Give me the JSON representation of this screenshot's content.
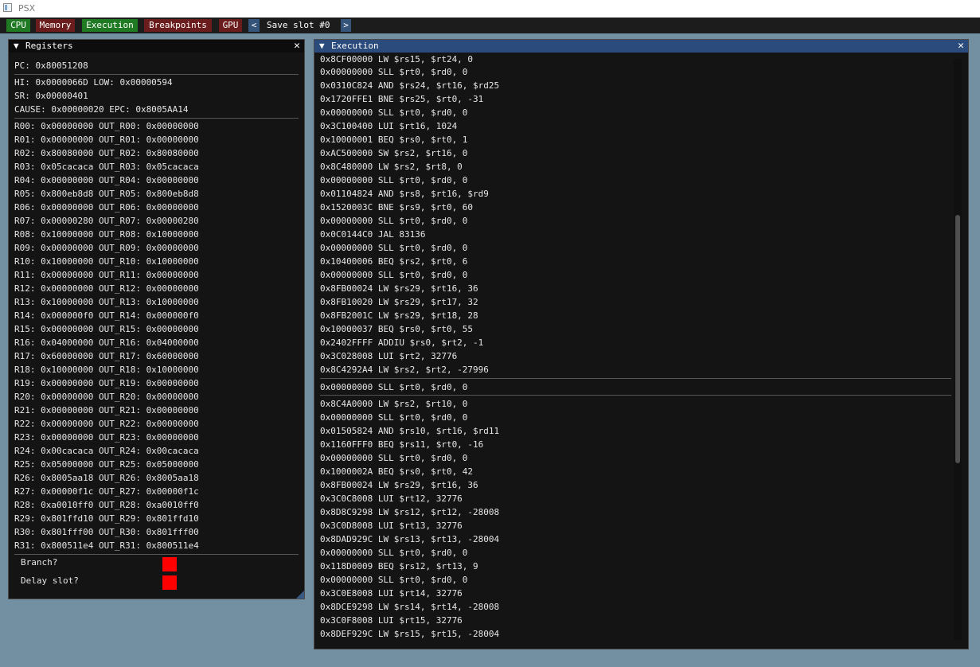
{
  "os_window": {
    "title": "PSX"
  },
  "menubar": {
    "buttons": [
      "CPU",
      "Memory",
      "Execution",
      "Breakpoints",
      "GPU"
    ],
    "prev_label": "<",
    "save_slot_label": "Save slot #0",
    "next_label": ">"
  },
  "registers_window": {
    "title": "Registers",
    "arrow": "▼",
    "close": "✕",
    "pc": "PC: 0x80051208",
    "hi_low": "HI: 0x0000066D LOW: 0x00000594",
    "sr": "SR: 0x00000401",
    "cause_epc": "CAUSE: 0x00000020 EPC: 0x8005AA14",
    "rows": [
      "R00: 0x00000000 OUT_R00: 0x00000000",
      "R01: 0x00000000 OUT_R01: 0x00000000",
      "R02: 0x80080000 OUT_R02: 0x80080000",
      "R03: 0x05cacaca OUT_R03: 0x05cacaca",
      "R04: 0x00000000 OUT_R04: 0x00000000",
      "R05: 0x800eb8d8 OUT_R05: 0x800eb8d8",
      "R06: 0x00000000 OUT_R06: 0x00000000",
      "R07: 0x00000280 OUT_R07: 0x00000280",
      "R08: 0x10000000 OUT_R08: 0x10000000",
      "R09: 0x00000000 OUT_R09: 0x00000000",
      "R10: 0x10000000 OUT_R10: 0x10000000",
      "R11: 0x00000000 OUT_R11: 0x00000000",
      "R12: 0x00000000 OUT_R12: 0x00000000",
      "R13: 0x10000000 OUT_R13: 0x10000000",
      "R14: 0x000000f0 OUT_R14: 0x000000f0",
      "R15: 0x00000000 OUT_R15: 0x00000000",
      "R16: 0x04000000 OUT_R16: 0x04000000",
      "R17: 0x60000000 OUT_R17: 0x60000000",
      "R18: 0x10000000 OUT_R18: 0x10000000",
      "R19: 0x00000000 OUT_R19: 0x00000000",
      "R20: 0x00000000 OUT_R20: 0x00000000",
      "R21: 0x00000000 OUT_R21: 0x00000000",
      "R22: 0x00000000 OUT_R22: 0x00000000",
      "R23: 0x00000000 OUT_R23: 0x00000000",
      "R24: 0x00cacaca OUT_R24: 0x00cacaca",
      "R25: 0x05000000 OUT_R25: 0x05000000",
      "R26: 0x8005aa18 OUT_R26: 0x8005aa18",
      "R27: 0x00000f1c OUT_R27: 0x00000f1c",
      "R28: 0xa0010ff0 OUT_R28: 0xa0010ff0",
      "R29: 0x801ffd10 OUT_R29: 0x801ffd10",
      "R30: 0x801fff00 OUT_R30: 0x801fff00",
      "R31: 0x800511e4 OUT_R31: 0x800511e4"
    ],
    "branch_label": "Branch?",
    "delay_slot_label": "Delay slot?"
  },
  "execution_window": {
    "title": "Execution",
    "arrow": "▼",
    "close": "✕",
    "partial_line": "0x8CF00000 LW $rs15, $rt24, 0",
    "before": [
      "0x00000000 SLL $rt0, $rd0, 0",
      "0x0310C824 AND $rs24, $rt16, $rd25",
      "0x1720FFE1 BNE $rs25, $rt0, -31",
      "0x00000000 SLL $rt0, $rd0, 0",
      "0x3C100400 LUI $rt16, 1024",
      "0x10000001 BEQ $rs0, $rt0, 1",
      "0xAC500000 SW $rs2, $rt16, 0",
      "0x8C480000 LW $rs2, $rt8, 0",
      "0x00000000 SLL $rt0, $rd0, 0",
      "0x01104824 AND $rs8, $rt16, $rd9",
      "0x1520003C BNE $rs9, $rt0, 60",
      "0x00000000 SLL $rt0, $rd0, 0",
      "0x0C0144C0 JAL 83136",
      "0x00000000 SLL $rt0, $rd0, 0",
      "0x10400006 BEQ $rs2, $rt0, 6",
      "0x00000000 SLL $rt0, $rd0, 0",
      "0x8FB00024 LW $rs29, $rt16, 36",
      "0x8FB10020 LW $rs29, $rt17, 32",
      "0x8FB2001C LW $rs29, $rt18, 28",
      "0x10000037 BEQ $rs0, $rt0, 55",
      "0x2402FFFF ADDIU $rs0, $rt2, -1",
      "0x3C028008 LUI $rt2, 32776",
      "0x8C4292A4 LW $rs2, $rt2, -27996"
    ],
    "current": "0x00000000 SLL $rt0, $rd0, 0",
    "after": [
      "0x8C4A0000 LW $rs2, $rt10, 0",
      "0x00000000 SLL $rt0, $rd0, 0",
      "0x01505824 AND $rs10, $rt16, $rd11",
      "0x1160FFF0 BEQ $rs11, $rt0, -16",
      "0x00000000 SLL $rt0, $rd0, 0",
      "0x1000002A BEQ $rs0, $rt0, 42",
      "0x8FB00024 LW $rs29, $rt16, 36",
      "0x3C0C8008 LUI $rt12, 32776",
      "0x8D8C9298 LW $rs12, $rt12, -28008",
      "0x3C0D8008 LUI $rt13, 32776",
      "0x8DAD929C LW $rs13, $rt13, -28004",
      "0x00000000 SLL $rt0, $rd0, 0",
      "0x118D0009 BEQ $rs12, $rt13, 9",
      "0x00000000 SLL $rt0, $rd0, 0",
      "0x3C0E8008 LUI $rt14, 32776",
      "0x8DCE9298 LW $rs14, $rt14, -28008",
      "0x3C0F8008 LUI $rt15, 32776",
      "0x8DEF929C LW $rs15, $rt15, -28004"
    ]
  },
  "colors": {
    "background": "#7390a3",
    "window_bg": "#141414",
    "active_title": "#2a4b7c",
    "flag_red": "#ff0000",
    "menu_green": "#207a24",
    "menu_red": "#6b1c1c",
    "menu_blue": "#34547a"
  }
}
